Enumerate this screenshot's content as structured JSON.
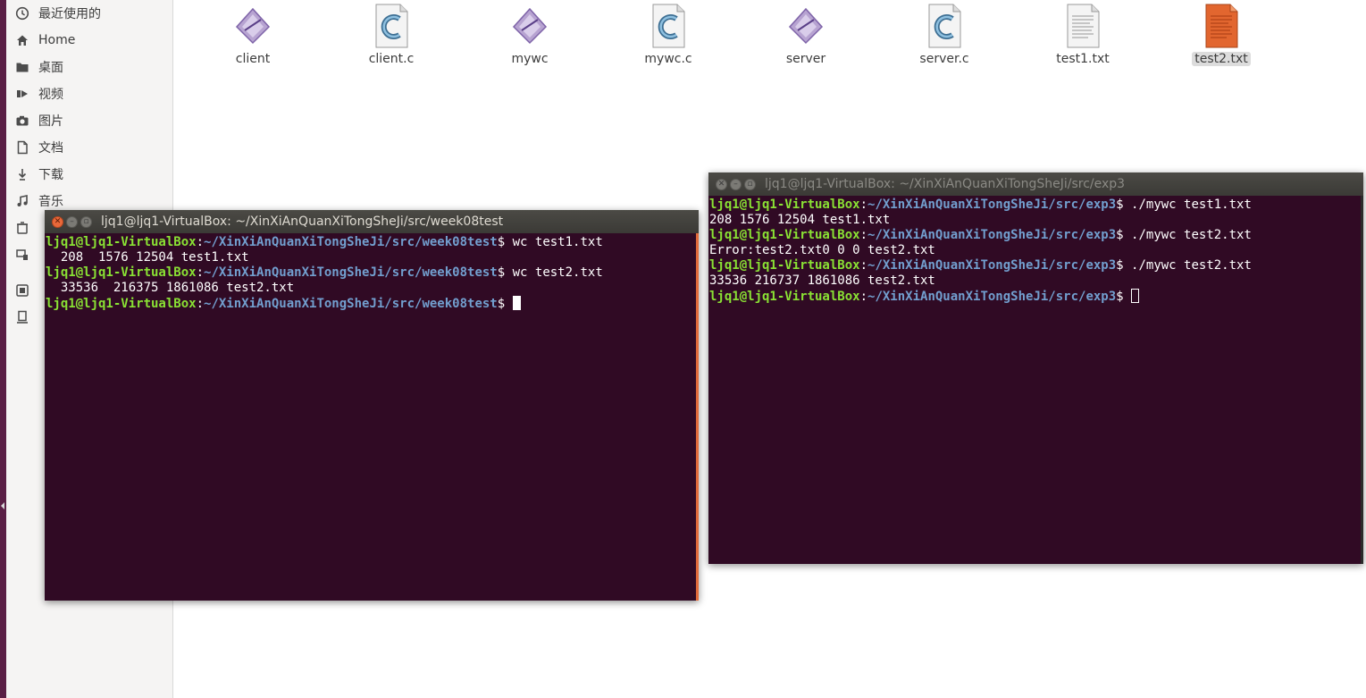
{
  "sidebar": {
    "items": [
      {
        "label": "最近使用的",
        "icon": "clock-icon"
      },
      {
        "label": "Home",
        "icon": "home-icon"
      },
      {
        "label": "桌面",
        "icon": "folder-icon"
      },
      {
        "label": "视频",
        "icon": "video-icon"
      },
      {
        "label": "图片",
        "icon": "camera-icon"
      },
      {
        "label": "文档",
        "icon": "document-icon"
      },
      {
        "label": "下载",
        "icon": "download-icon"
      },
      {
        "label": "音乐",
        "icon": "music-icon"
      }
    ]
  },
  "files": [
    {
      "name": "client",
      "icon": "executable-icon"
    },
    {
      "name": "client.c",
      "icon": "c-source-icon"
    },
    {
      "name": "mywc",
      "icon": "executable-icon"
    },
    {
      "name": "mywc.c",
      "icon": "c-source-icon"
    },
    {
      "name": "server",
      "icon": "executable-icon"
    },
    {
      "name": "server.c",
      "icon": "c-source-icon"
    },
    {
      "name": "test1.txt",
      "icon": "text-file-icon"
    },
    {
      "name": "test2.txt",
      "icon": "text-file-icon-orange",
      "selected": true
    }
  ],
  "terminal1": {
    "title": "ljq1@ljq1-VirtualBox: ~/XinXiAnQuanXiTongSheJi/src/week08test",
    "user": "ljq1@ljq1-VirtualBox",
    "path": "~/XinXiAnQuanXiTongSheJi/src/week08test",
    "lines": [
      {
        "type": "cmd",
        "cmd": "wc test1.txt"
      },
      {
        "type": "out",
        "text": "  208  1576 12504 test1.txt"
      },
      {
        "type": "cmd",
        "cmd": "wc test2.txt"
      },
      {
        "type": "out",
        "text": "  33536  216375 1861086 test2.txt"
      },
      {
        "type": "prompt"
      }
    ]
  },
  "terminal2": {
    "title": "ljq1@ljq1-VirtualBox: ~/XinXiAnQuanXiTongSheJi/src/exp3",
    "user": "ljq1@ljq1-VirtualBox",
    "path": "~/XinXiAnQuanXiTongSheJi/src/exp3",
    "lines": [
      {
        "type": "cmd",
        "cmd": "./mywc test1.txt"
      },
      {
        "type": "out",
        "text": "208 1576 12504 test1.txt"
      },
      {
        "type": "cmd",
        "cmd": "./mywc test2.txt"
      },
      {
        "type": "out",
        "text": "Error:test2.txt0 0 0 test2.txt"
      },
      {
        "type": "cmd",
        "cmd": "./mywc test2.txt"
      },
      {
        "type": "out",
        "text": "33536 216737 1861086 test2.txt"
      },
      {
        "type": "prompt"
      }
    ]
  }
}
